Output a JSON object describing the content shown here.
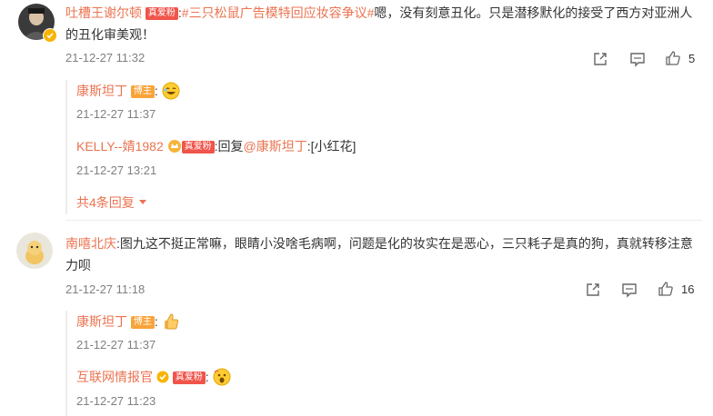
{
  "comments": [
    {
      "username": "吐槽王谢尔顿",
      "fan_badge": "真爱粉",
      "topic": "#三只松鼠广告模特回应妆容争议#",
      "text": "嗯，没有刻意丑化。只是潜移默化的接受了西方对亚洲人的丑化审美观！",
      "time": "21-12-27 11:32",
      "likes": "5",
      "replies": [
        {
          "username": "康斯坦丁",
          "host_badge": "博主",
          "text": "",
          "time": "21-12-27 11:37"
        },
        {
          "username": "KELLY--婧1982",
          "fan_badge": "真爱粉",
          "reply_prefix": "回复",
          "mention": "@康斯坦丁",
          "text": "[小红花]",
          "time": "21-12-27 13:21"
        }
      ],
      "more_replies": "共4条回复"
    },
    {
      "username": "南嘻北庆",
      "text": "图九这不挺正常嘛，眼睛小没啥毛病啊，问题是化的妆实在是恶心，三只耗子是真的狗，真就转移注意力呗",
      "time": "21-12-27 11:18",
      "likes": "16",
      "replies": [
        {
          "username": "康斯坦丁",
          "host_badge": "博主",
          "text": "",
          "time": "21-12-27 11:37"
        },
        {
          "username": "互联网情报官",
          "fan_badge": "真爱粉",
          "text": "",
          "time": "21-12-27 11:23"
        }
      ]
    }
  ],
  "icons": {
    "share": "share-icon",
    "comment": "comment-icon",
    "like": "thumbs-up-icon",
    "verified": "verified-badge-icon",
    "laugh": "laughing-emoji-icon",
    "thumb": "thumbs-up-emoji-icon",
    "shocked": "shocked-emoji-icon",
    "dropdown": "caret-down-icon"
  },
  "colors": {
    "username": "#eb7350",
    "fan_badge": "#f0544a",
    "host_badge": "#f8a43a",
    "time": "#808080"
  }
}
